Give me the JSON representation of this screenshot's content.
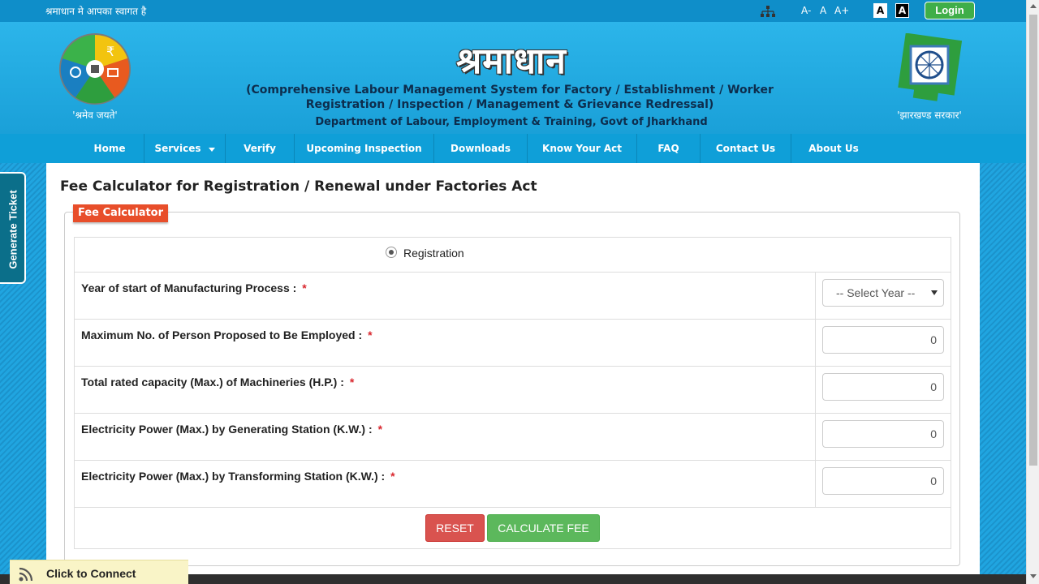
{
  "topbar": {
    "welcome": "श्रमाधान मे आपका स्वागत है",
    "font_small": "A-",
    "font_normal": "A",
    "font_large": "A+",
    "contrast_white": "A",
    "contrast_black": "A",
    "login": "Login"
  },
  "header": {
    "brand": "श्रमाधान",
    "subtitle": "(Comprehensive Labour Management System for Factory / Establishment / Worker Registration / Inspection / Management & Grievance Redressal)",
    "department": "Department of Labour, Employment & Training, Govt of Jharkhand",
    "left_logo_caption": "'श्रमेव जयते'",
    "right_logo_caption": "'झारखण्ड सरकार'"
  },
  "nav": {
    "items": [
      "Home",
      "Services",
      "Verify",
      "Upcoming Inspection",
      "Downloads",
      "Know Your Act",
      "FAQ",
      "Contact Us",
      "About Us"
    ]
  },
  "main": {
    "title": "Fee Calculator for Registration / Renewal under Factories Act",
    "legend": "Fee Calculator",
    "radio_label": "Registration",
    "fields": [
      {
        "label": "Year of start of Manufacturing Process :",
        "value": "-- Select Year --"
      },
      {
        "label": "Maximum No. of Person Proposed to Be Employed :",
        "value": "0"
      },
      {
        "label": "Total rated capacity (Max.) of Machineries (H.P.) :",
        "value": "0"
      },
      {
        "label": "Electricity Power (Max.) by Generating Station (K.W.) :",
        "value": "0"
      },
      {
        "label": "Electricity Power (Max.) by Transforming Station (K.W.) :",
        "value": "0"
      }
    ],
    "required_mark": "*",
    "reset_label": "RESET",
    "calculate_label": "CALCULATE FEE"
  },
  "side": {
    "generate_ticket": "Generate Ticket",
    "click_to_connect": "Click to Connect"
  },
  "colors": {
    "header_bg": "#1aa3db",
    "nav_bg": "#0f9fd8",
    "legend_bg": "#e84e2a",
    "reset_btn": "#d9534f",
    "calc_btn": "#5cb85c",
    "login_btn": "#3fae49"
  },
  "icons": [
    "sitemap-icon",
    "rss-icon",
    "ashoka-emblem-icon",
    "shramev-jayate-logo"
  ]
}
